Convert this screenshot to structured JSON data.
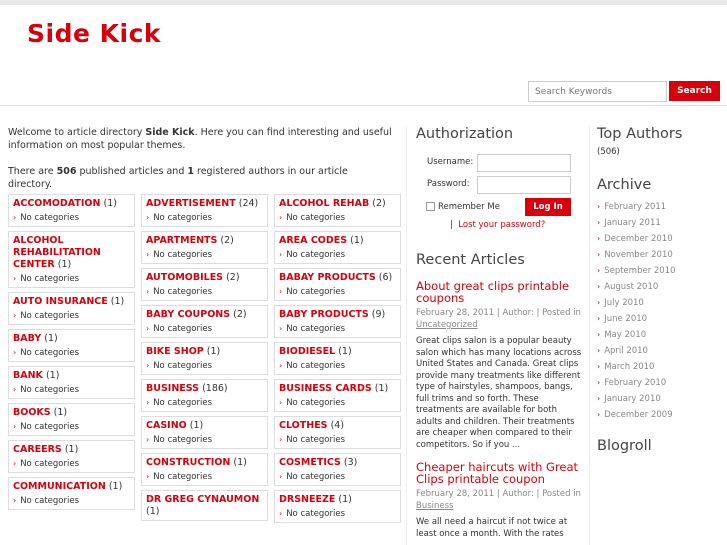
{
  "site": {
    "title": "Side Kick"
  },
  "search": {
    "placeholder": "Search Keywords",
    "button": "Search"
  },
  "intro": {
    "p1_a": "Welcome to article directory ",
    "p1_b": "Side Kick",
    "p1_c": ". Here you can find interesting and useful information on most popular themes.",
    "p2_a": "There are ",
    "p2_b": "506",
    "p2_c": " published articles and ",
    "p2_d": "1",
    "p2_e": " registered authors in our article directory."
  },
  "categories": {
    "col1": [
      {
        "name": "ACCOMODATION",
        "count": "(1)",
        "sub": "No categories"
      },
      {
        "name": "ALCOHOL REHABILITATION CENTER",
        "count": "(1)",
        "sub": "No categories"
      },
      {
        "name": "AUTO INSURANCE",
        "count": "(1)",
        "sub": "No categories"
      },
      {
        "name": "BABY",
        "count": "(1)",
        "sub": "No categories"
      },
      {
        "name": "BANK",
        "count": "(1)",
        "sub": "No categories"
      },
      {
        "name": "BOOKS",
        "count": "(1)",
        "sub": "No categories"
      },
      {
        "name": "CAREERS",
        "count": "(1)",
        "sub": "No categories"
      },
      {
        "name": "COMMUNICATION",
        "count": "(1)",
        "sub": "No categories"
      }
    ],
    "col2": [
      {
        "name": "ADVERTISEMENT",
        "count": "(24)",
        "sub": "No categories"
      },
      {
        "name": "APARTMENTS",
        "count": "(2)",
        "sub": "No categories"
      },
      {
        "name": "AUTOMOBILES",
        "count": "(2)",
        "sub": "No categories"
      },
      {
        "name": "BABY COUPONS",
        "count": "(2)",
        "sub": "No categories"
      },
      {
        "name": "BIKE SHOP",
        "count": "(1)",
        "sub": "No categories"
      },
      {
        "name": "BUSINESS",
        "count": "(186)",
        "sub": "No categories"
      },
      {
        "name": "CASINO",
        "count": "(1)",
        "sub": "No categories"
      },
      {
        "name": "CONSTRUCTION",
        "count": "(1)",
        "sub": "No categories"
      },
      {
        "name": "DR GREG CYNAUMON",
        "count": "(1)",
        "sub": ""
      }
    ],
    "col3": [
      {
        "name": "ALCOHOL REHAB",
        "count": "(2)",
        "sub": "No categories"
      },
      {
        "name": "AREA CODES",
        "count": "(1)",
        "sub": "No categories"
      },
      {
        "name": "BABAY PRODUCTS",
        "count": "(6)",
        "sub": "No categories"
      },
      {
        "name": "BABY PRODUCTS",
        "count": "(9)",
        "sub": "No categories"
      },
      {
        "name": "BIODIESEL",
        "count": "(1)",
        "sub": "No categories"
      },
      {
        "name": "BUSINESS CARDS",
        "count": "(1)",
        "sub": "No categories"
      },
      {
        "name": "CLOTHES",
        "count": "(4)",
        "sub": "No categories"
      },
      {
        "name": "COSMETICS",
        "count": "(3)",
        "sub": "No categories"
      },
      {
        "name": "DRSNEEZE",
        "count": "(1)",
        "sub": "No categories"
      }
    ]
  },
  "auth": {
    "title": "Authorization",
    "username_label": "Username:",
    "password_label": "Password:",
    "remember": "Remember Me",
    "login": "Log In",
    "lost_sep": "|",
    "lost": "Lost your password?"
  },
  "recent": {
    "title": "Recent Articles",
    "articles": [
      {
        "title": "About great clips printable coupons",
        "meta": "February 28, 2011 | Author: | Posted in",
        "category": "Uncategorized",
        "body": "Great clips salon is a popular beauty salon which has many locations across United States and Canada. Great clips provide many treatments like different type of hairstyles, shampoos, bangs, full trims and so forth. These treatments are available for both adults and children. Their treatments are cheaper when compared to their competitors. So if you ..."
      },
      {
        "title": "Cheaper haircuts with Great Clips printable coupon",
        "meta": "February 28, 2011 | Author: | Posted in",
        "category": "Business",
        "body": "We all need a haircut if not twice at least once a month. With the rates"
      }
    ]
  },
  "top_authors": {
    "title": "Top Authors",
    "count": "(506)"
  },
  "archive": {
    "title": "Archive",
    "items": [
      "February 2011",
      "January 2011",
      "December 2010",
      "November 2010",
      "September 2010",
      "August 2010",
      "July 2010",
      "June 2010",
      "May 2010",
      "April 2010",
      "March 2010",
      "February 2010",
      "January 2010",
      "December 2009"
    ]
  },
  "blogroll": {
    "title": "Blogroll"
  },
  "colors": {
    "accent": "#d8000a",
    "text": "#333333",
    "muted": "#888888",
    "border": "#dddddd"
  }
}
